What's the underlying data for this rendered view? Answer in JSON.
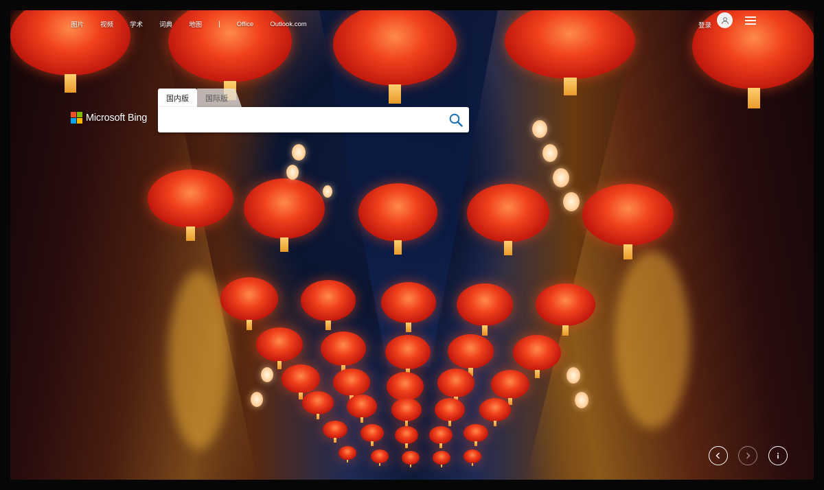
{
  "nav": {
    "links": [
      "图片",
      "视频",
      "学术",
      "词典",
      "地图"
    ],
    "separator": "|",
    "extra_links": [
      "Office",
      "Outlook.com"
    ]
  },
  "header": {
    "login_label": "登录"
  },
  "brand": {
    "name": "Microsoft Bing",
    "logo_colors": [
      "#f25022",
      "#7fba00",
      "#00a4ef",
      "#ffb900"
    ]
  },
  "search": {
    "tabs": [
      "国内版",
      "国际版"
    ],
    "active_tab": "国内版",
    "value": "",
    "placeholder": ""
  },
  "controls": {
    "icons": [
      "chevron-left-icon",
      "chevron-right-icon",
      "info-icon"
    ]
  },
  "colors": {
    "search_icon": "#1a6fb0"
  }
}
